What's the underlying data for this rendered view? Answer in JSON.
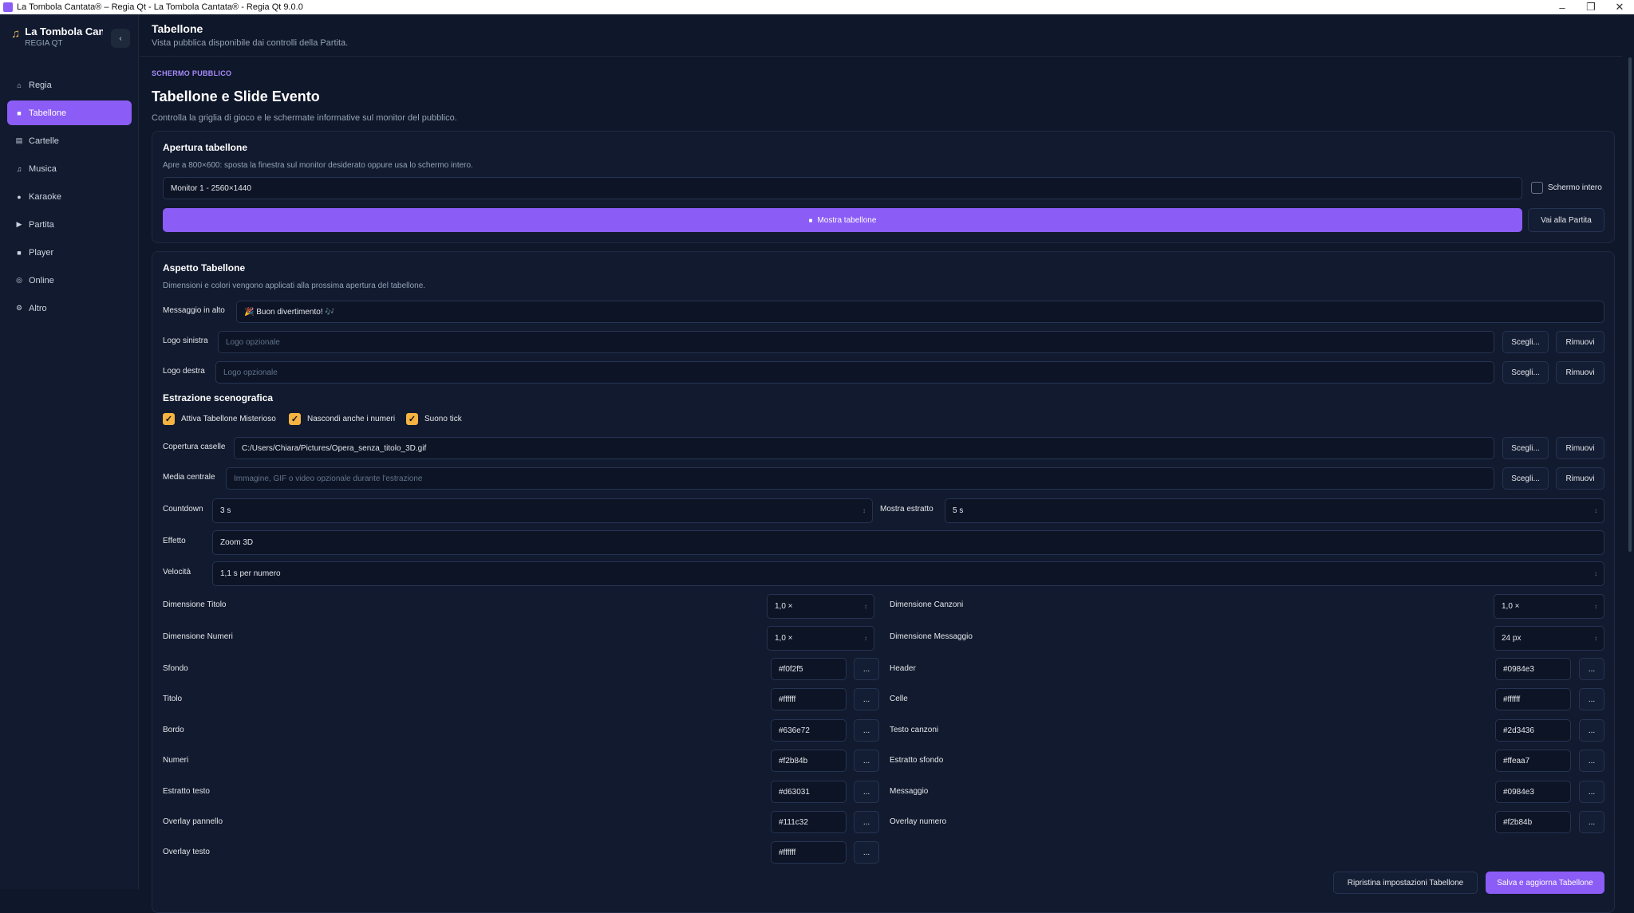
{
  "window": {
    "title": "La Tombola Cantata® – Regia Qt - La Tombola Cantata® - Regia Qt 9.0.0"
  },
  "brand": {
    "name": "La Tombola Cantata",
    "sub": "REGIA QT",
    "collapse_glyph": "‹"
  },
  "nav": [
    {
      "label": "Regia",
      "icon": "home-icon",
      "glyph": "⌂"
    },
    {
      "label": "Tabellone",
      "icon": "board-icon",
      "glyph": "■",
      "active": true
    },
    {
      "label": "Cartelle",
      "icon": "card-icon",
      "glyph": "▤"
    },
    {
      "label": "Musica",
      "icon": "music-icon",
      "glyph": "♫"
    },
    {
      "label": "Karaoke",
      "icon": "mic-icon",
      "glyph": "●"
    },
    {
      "label": "Partita",
      "icon": "play-icon",
      "glyph": "▶"
    },
    {
      "label": "Player",
      "icon": "player-icon",
      "glyph": "■"
    },
    {
      "label": "Online",
      "icon": "globe-icon",
      "glyph": "◎"
    },
    {
      "label": "Altro",
      "icon": "gear-icon",
      "glyph": "⚙"
    }
  ],
  "header": {
    "title": "Tabellone",
    "subtitle": "Vista pubblica disponibile dai controlli della Partita."
  },
  "page": {
    "kicker": "SCHERMO PUBBLICO",
    "title": "Tabellone e Slide Evento",
    "lead": "Controlla la griglia di gioco e le schermate informative sul monitor del pubblico."
  },
  "apertura": {
    "title": "Apertura tabellone",
    "subtitle": "Apre a 800×600: sposta la finestra sul monitor desiderato oppure usa lo schermo intero.",
    "monitor": "Monitor 1 - 2560×1440",
    "fullscreen_label": "Schermo intero",
    "show_button": "Mostra tabellone",
    "go_button": "Vai alla Partita"
  },
  "aspetto": {
    "title": "Aspetto Tabellone",
    "subtitle": "Dimensioni e colori vengono applicati alla prossima apertura del tabellone.",
    "messaggio_label": "Messaggio in alto",
    "messaggio_value": "🎉 Buon divertimento! 🎶",
    "logo_sx_label": "Logo sinistra",
    "logo_dx_label": "Logo destra",
    "logo_placeholder": "Logo opzionale",
    "scegli": "Scegli...",
    "rimuovi": "Rimuovi"
  },
  "estrazione": {
    "title": "Estrazione scenografica",
    "chk1": "Attiva Tabellone Misterioso",
    "chk2": "Nascondi anche i numeri",
    "chk3": "Suono tick",
    "copertura_label": "Copertura caselle",
    "copertura_value": "C:/Users/Chiara/Pictures/Opera_senza_titolo_3D.gif",
    "media_label": "Media centrale",
    "media_placeholder": "Immagine, GIF o video opzionale durante l'estrazione",
    "countdown_label": "Countdown",
    "countdown_value": "3 s",
    "mostra_label": "Mostra estratto",
    "mostra_value": "5 s",
    "effetto_label": "Effetto",
    "effetto_value": "Zoom 3D",
    "velocita_label": "Velocità",
    "velocita_value": "1,1 s per numero"
  },
  "dimensioni": {
    "titolo_label": "Dimensione Titolo",
    "titolo_value": "1,0 ×",
    "canzoni_label": "Dimensione Canzoni",
    "canzoni_value": "1,0 ×",
    "numeri_label": "Dimensione Numeri",
    "numeri_value": "1,0 ×",
    "messaggio_label": "Dimensione Messaggio",
    "messaggio_value": "24 px"
  },
  "colori_sx": [
    {
      "label": "Sfondo",
      "value": "#f0f2f5"
    },
    {
      "label": "Titolo",
      "value": "#ffffff"
    },
    {
      "label": "Bordo",
      "value": "#636e72"
    },
    {
      "label": "Numeri",
      "value": "#f2b84b"
    },
    {
      "label": "Estratto testo",
      "value": "#d63031"
    },
    {
      "label": "Overlay pannello",
      "value": "#111c32"
    },
    {
      "label": "Overlay testo",
      "value": "#ffffff"
    }
  ],
  "colori_dx": [
    {
      "label": "Header",
      "value": "#0984e3"
    },
    {
      "label": "Celle",
      "value": "#ffffff"
    },
    {
      "label": "Testo canzoni",
      "value": "#2d3436"
    },
    {
      "label": "Estratto sfondo",
      "value": "#ffeaa7"
    },
    {
      "label": "Messaggio",
      "value": "#0984e3"
    },
    {
      "label": "Overlay numero",
      "value": "#f2b84b"
    }
  ],
  "picker_label": "...",
  "footer": {
    "reset": "Ripristina impostazioni Tabellone",
    "save": "Salva e aggiorna Tabellone"
  }
}
